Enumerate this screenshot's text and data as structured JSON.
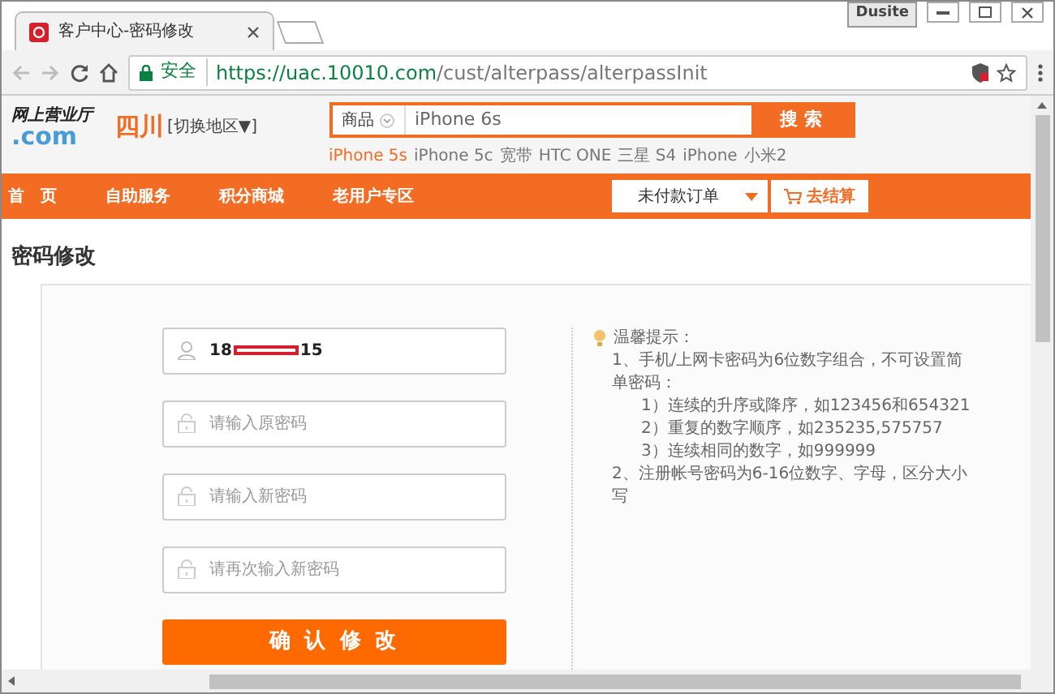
{
  "browser": {
    "tab_title": "客户中心-密码修改",
    "profile_button": "Dusite",
    "security_label": "安全",
    "url_host": "https://uac.10010.com",
    "url_path": "/cust/alterpass/alterpassInit"
  },
  "header": {
    "logo_line1": "网上营业厅",
    "logo_line2": ".com",
    "province": "四川",
    "switch_region": "[切换地区▼]",
    "search": {
      "category": "商品",
      "value": "iPhone 6s",
      "button": "搜 索"
    },
    "hot_keywords": [
      {
        "label": "iPhone 5s",
        "highlighted": true
      },
      {
        "label": "iPhone 5c",
        "highlighted": false
      },
      {
        "label": "宽带",
        "highlighted": false
      },
      {
        "label": "HTC ONE",
        "highlighted": false
      },
      {
        "label": "三星 S4",
        "highlighted": false
      },
      {
        "label": "iPhone",
        "highlighted": false
      },
      {
        "label": "小米2",
        "highlighted": false
      }
    ]
  },
  "nav": {
    "items": [
      "首　页",
      "自助服务",
      "积分商城",
      "老用户专区"
    ],
    "order_dropdown": "未付款订单",
    "checkout_button": "去结算"
  },
  "page_title": "密码修改",
  "form": {
    "account": {
      "prefix": "18",
      "suffix": "15",
      "redacted": true
    },
    "fields": [
      {
        "placeholder": "请输入原密码"
      },
      {
        "placeholder": "请输入新密码"
      },
      {
        "placeholder": "请再次输入新密码"
      }
    ],
    "submit": "确 认 修 改"
  },
  "tips": {
    "title": "温馨提示：",
    "items": [
      {
        "text": "1、手机/上网卡密码为6位数字组合，不可设置简单密码：",
        "children": [
          {
            "text": "1）连续的升序或降序，如123456和654321"
          },
          {
            "text": "2）重复的数字顺序，如235235,575757"
          },
          {
            "text": "3）连续相同的数字，如999999"
          }
        ]
      },
      {
        "text": "2、注册帐号密码为6-16位数字、字母，区分大小写"
      }
    ]
  }
}
